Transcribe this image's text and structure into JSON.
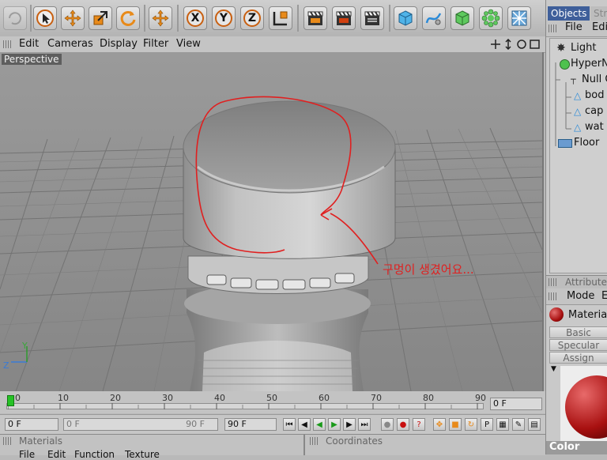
{
  "menubar": {
    "items": [
      "Edit",
      "Cameras",
      "Display",
      "Filter",
      "View"
    ]
  },
  "viewport": {
    "label": "Perspective",
    "annotation_text": "구멍이 생겼어요...",
    "axis_y": "Y",
    "axis_z": "Z"
  },
  "toolbar": {
    "axis_x": "X",
    "axis_y": "Y",
    "axis_z": "Z"
  },
  "objects_panel": {
    "tabs": [
      "Objects",
      "Stru"
    ],
    "menu": [
      "File",
      "Edi"
    ],
    "items": [
      {
        "label": "Light",
        "icon": "light-icon"
      },
      {
        "label": "HyperN",
        "icon": "hypernurbs-icon"
      },
      {
        "label": "Null O",
        "icon": "null-icon"
      },
      {
        "label": "bod",
        "icon": "polygon-icon"
      },
      {
        "label": "cap",
        "icon": "polygon-icon"
      },
      {
        "label": "wat",
        "icon": "polygon-icon"
      },
      {
        "label": "Floor",
        "icon": "floor-icon"
      }
    ]
  },
  "attributes_panel": {
    "title": "Attributes",
    "mode_label": "Mode",
    "mode_extra": "E",
    "material_label": "Material",
    "tabs": [
      "Basic",
      "Specular",
      "Assign"
    ],
    "color_label": "Color"
  },
  "timeline": {
    "ticks": [
      "0",
      "10",
      "20",
      "30",
      "40",
      "50",
      "60",
      "70",
      "80",
      "90"
    ],
    "current_frame": "0 F"
  },
  "transport": {
    "start_field": "0 F",
    "range_start": "0 F",
    "range_end": "90 F",
    "end_field": "90 F"
  },
  "bottom": {
    "materials_title": "Materials",
    "coordinates_title": "Coordinates",
    "materials_menu": [
      "File",
      "Edit",
      "Function",
      "Texture"
    ]
  },
  "colors": {
    "annotation": "#e02020",
    "accent_orange": "#e88a1a",
    "material_red": "#a81010"
  }
}
